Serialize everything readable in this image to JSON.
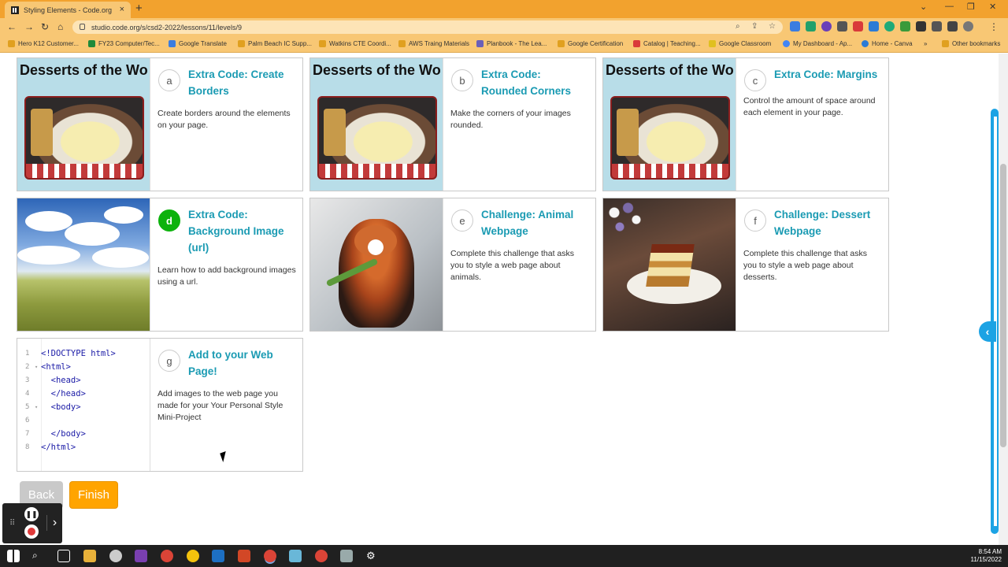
{
  "browser": {
    "tab_title": "Styling Elements - Code.org",
    "tab_close": "×",
    "new_tab": "+",
    "url": "studio.code.org/s/csd2-2022/lessons/11/levels/9",
    "bookmarks": [
      "Hero K12 Customer...",
      "FY23 Computer/Tec...",
      "Google Translate",
      "Palm Beach IC Supp...",
      "Watkins CTE Coordi...",
      "AWS Traing Materials",
      "Planbook - The Lea...",
      "Google Certification",
      "Catalog | Teaching...",
      "Google Classroom",
      "My Dashboard - Ap...",
      "Home - Canva",
      "Other bookmarks"
    ],
    "bookmarks_more": "»"
  },
  "cards": [
    {
      "letter": "a",
      "title": "Extra Code: Create Borders",
      "desc": "Create borders around the elements on your page.",
      "thumb_header": "Desserts of the Wo"
    },
    {
      "letter": "b",
      "title": "Extra Code: Rounded Corners",
      "desc": "Make the corners of your images rounded.",
      "thumb_header": "Desserts of the Wo"
    },
    {
      "letter": "c",
      "title": "Extra Code: Margins",
      "desc": "Control the amount of space around each element in your page.",
      "thumb_header": "Desserts of the Wo"
    },
    {
      "letter": "d",
      "title": "Extra Code: Background Image (url)",
      "desc": "Learn how to add background images using a url."
    },
    {
      "letter": "e",
      "title": "Challenge: Animal Webpage",
      "desc": "Complete this challenge that asks you to style a web page about animals."
    },
    {
      "letter": "f",
      "title": "Challenge: Dessert Webpage",
      "desc": "Complete this challenge that asks you to style a web page about desserts."
    },
    {
      "letter": "g",
      "title": "Add to your Web Page!",
      "desc": "Add images to the web page you made for your Your Personal Style Mini-Project"
    }
  ],
  "code_lines": [
    {
      "n": "1",
      "arrow": "",
      "text": "<!DOCTYPE html>"
    },
    {
      "n": "2",
      "arrow": "▾",
      "text": "<html>"
    },
    {
      "n": "3",
      "arrow": "",
      "text": "  <head>"
    },
    {
      "n": "4",
      "arrow": "",
      "text": "  </head>"
    },
    {
      "n": "5",
      "arrow": "▾",
      "text": "  <body>"
    },
    {
      "n": "6",
      "arrow": "",
      "text": ""
    },
    {
      "n": "7",
      "arrow": "",
      "text": "  </body>"
    },
    {
      "n": "8",
      "arrow": "",
      "text": "</html>"
    }
  ],
  "buttons": {
    "back": "Back",
    "finish": "Finish"
  },
  "taskbar": {
    "time": "8:54 AM",
    "date": "11/15/2022"
  },
  "colors": {
    "accent": "#1b9bb3",
    "active_badge": "#0cb20c",
    "finish": "#ffa400",
    "chrome": "#f2a22e"
  }
}
